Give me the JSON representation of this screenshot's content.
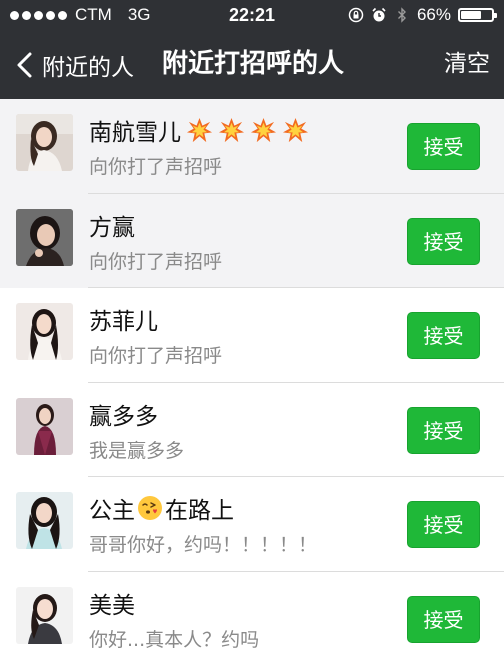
{
  "status_bar": {
    "carrier": "CTM",
    "network": "3G",
    "time": "22:21",
    "battery_percent": "66%",
    "battery_level": 0.66,
    "icons": [
      "signal-dots",
      "lock-rotation-icon",
      "alarm-icon",
      "bluetooth-icon",
      "battery-icon"
    ]
  },
  "nav": {
    "back_label": "附近的人",
    "title": "附近打招呼的人",
    "clear_label": "清空"
  },
  "colors": {
    "header_bg": "#2f3135",
    "accent_green": "#1fb838",
    "secondary_text": "#8a8a8a"
  },
  "rows": [
    {
      "name": "南航雪儿",
      "name_suffix_icons": [
        "collision-emoji-icon",
        "collision-emoji-icon",
        "collision-emoji-icon",
        "collision-emoji-icon"
      ],
      "message": "向你打了声招呼",
      "button": "接受"
    },
    {
      "name": "方赢",
      "message": "向你打了声招呼",
      "button": "接受"
    },
    {
      "name": "苏菲儿",
      "message": "向你打了声招呼",
      "button": "接受"
    },
    {
      "name": "赢多多",
      "message": "我是赢多多",
      "button": "接受"
    },
    {
      "name_part1": "公主",
      "name_inline_icon": "kissing-face-emoji-icon",
      "name_part2": "在路上",
      "message": "哥哥你好，约吗！！！！！",
      "button": "接受"
    },
    {
      "name": "美美",
      "message": "你好...真本人？约吗",
      "button": "接受"
    }
  ]
}
